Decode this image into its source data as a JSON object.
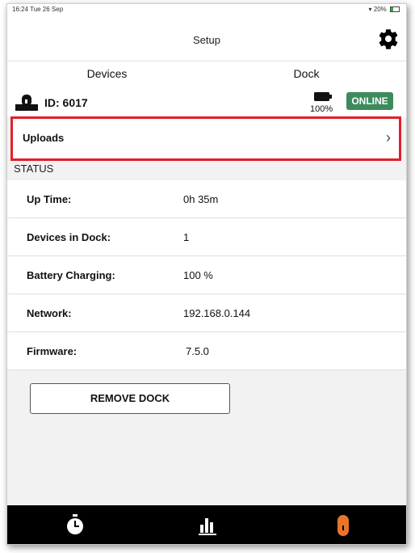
{
  "status_bar": {
    "time_date": "16:24  Tue 26 Sep",
    "battery_text": "20%"
  },
  "nav": {
    "title": "Setup",
    "settings_icon": "gear-icon"
  },
  "tabs": [
    {
      "label": "Devices",
      "selected": false
    },
    {
      "label": "Dock",
      "selected": true
    }
  ],
  "dock": {
    "id_label": "ID: 6017",
    "battery_percent": "100%",
    "online_badge": "ONLINE",
    "dock_icon": "dock-icon",
    "battery_icon": "battery-icon"
  },
  "uploads": {
    "label": "Uploads",
    "chevron": "›"
  },
  "status": {
    "header": "STATUS",
    "rows": [
      {
        "key": "Up Time:",
        "value": "0h 35m"
      },
      {
        "key": "Devices in Dock:",
        "value": "1"
      },
      {
        "key": "Battery Charging:",
        "value": "100 %"
      },
      {
        "key": "Network:",
        "value": "192.168.0.144"
      },
      {
        "key": "Firmware:",
        "value": "7.5.0"
      }
    ]
  },
  "actions": {
    "remove_dock": "REMOVE DOCK"
  },
  "bottom_tabs": [
    {
      "name": "timer-tab",
      "icon": "stopwatch-icon"
    },
    {
      "name": "stats-tab",
      "icon": "bar-chart-icon"
    },
    {
      "name": "device-tab",
      "icon": "device-icon",
      "active_color": "#e8752a"
    }
  ],
  "colors": {
    "accent": "#e8752a",
    "online": "#3d8b5c",
    "highlight_border": "#e0202a"
  }
}
